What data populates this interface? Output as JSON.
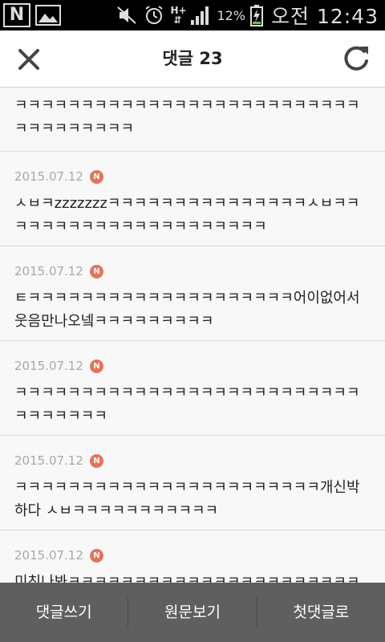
{
  "status_bar": {
    "battery_percent": "12%",
    "clock": "오전 12:43",
    "network": "H+"
  },
  "header": {
    "title": "댓글 23"
  },
  "comments": [
    {
      "date": "",
      "badge": "",
      "text": "ㅋㅋㅋㅋㅋㅋㅋㅋㅋㅋㅋㅋㅋㅋㅋㅋㅋㅋㅋㅋㅋㅋㅋㅋㅋㅋㅋㅋㅋㅋㅋㅋㅋㅋㅋ"
    },
    {
      "date": "2015.07.12",
      "badge": "N",
      "text": "ㅅㅂㅋzzzzzzzㅋㅋㅋㅋㅋㅋㅋㅋㅋㅋㅋㅋㅋㅋㅋㅅㅂㅋㅋㅋㅋㅋㅋㅋㅋㅋㅋㅋㅋㅋㅋㅋㅋㅋㅋㅋㅋㅋ"
    },
    {
      "date": "2015.07.12",
      "badge": "N",
      "text": "ㅌㅋㅋㅋㅋㅋㅋㅋㅋㅋㅋㅋㅋㅋㅋㅋㅋㅋㅋㅋㅋ어이없어서 웃음만나오넼ㅋㅋㅋㅋㅋㅋㅋㅋㅋ"
    },
    {
      "date": "2015.07.12",
      "badge": "N",
      "text": "ㅋㅋㅋㅋㅋㅋㅋㅋㅋㅋㅋㅋㅋㅋㅋㅋㅋㅋㅋㅋㅋㅋㅋㅋㅋㅋㅋㅋㅋㅋㅋㅋㅋ"
    },
    {
      "date": "2015.07.12",
      "badge": "N",
      "text": "ㅋㅋㅋㅋㅋㅋㅋㅋㅋㅋㅋㅋㅋㅋㅋㅋㅋㅋㅋㅋㅋㅋㅋ개신박하다 ㅅㅂㅋㅋㅋㅋㅋㅋㅋㅋㅋㅋㅋ"
    },
    {
      "date": "2015.07.12",
      "badge": "N",
      "text": "미친나봐ㅋㅋㅋㅋㅋㅋㅋㅋㅋㅋㅋㅋㅋㅋㅋㅋㅋㅋㅋㅋㅋㅋㅋ"
    }
  ],
  "bottom_bar": {
    "write_comment": "댓글쓰기",
    "view_original": "원문보기",
    "first_comment": "첫댓글로"
  },
  "colors": {
    "badge": "#e4735b",
    "bottom_bar": "#5f5f5f"
  }
}
